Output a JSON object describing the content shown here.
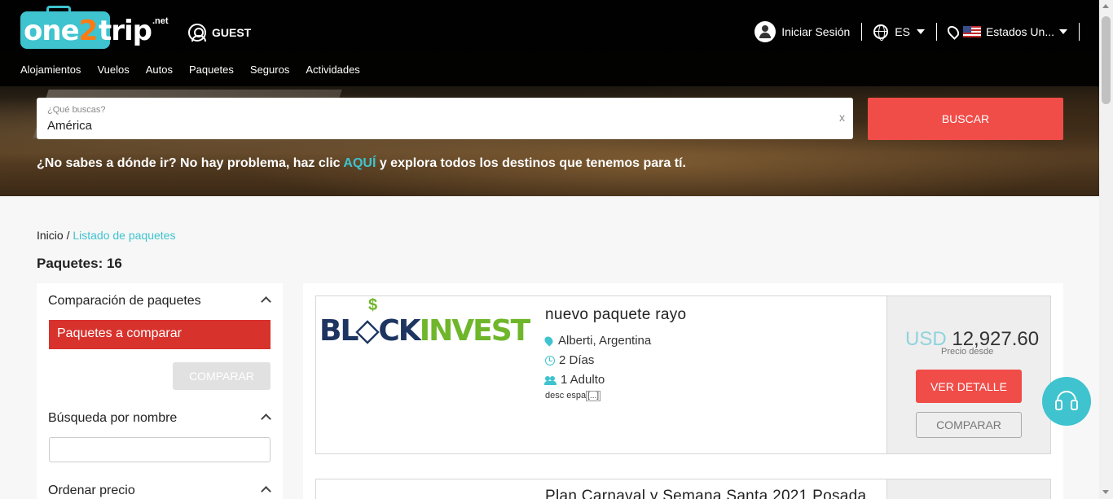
{
  "brand": {
    "name_part1": "one",
    "name_part2": "2",
    "name_part3": "trip",
    "tld": ".net",
    "colors": {
      "accent": "#3ec3cf",
      "orange": "#ff7a12",
      "red": "#f04c48"
    }
  },
  "header": {
    "guest_label": "GUEST",
    "login_label": "Iniciar Sesión",
    "language": "ES",
    "country": "Estados Un...",
    "nav": [
      "Alojamientos",
      "Vuelos",
      "Autos",
      "Paquetes",
      "Seguros",
      "Actividades"
    ]
  },
  "search": {
    "label": "¿Qué buscas?",
    "value": "América",
    "clear": "x",
    "button": "BUSCAR",
    "hint_before": "¿No sabes a dónde ir? No hay problema, haz clic ",
    "hint_link": "AQUÍ",
    "hint_after": " y explora todos los destinos que tenemos para tí."
  },
  "breadcrumb": {
    "home": "Inicio",
    "separator": "/",
    "current": "Listado de paquetes"
  },
  "results_count": "Paquetes: 16",
  "sidebar": {
    "compare_title": "Comparación de paquetes",
    "compare_list_label": "Paquetes a comparar",
    "compare_button": "COMPARAR",
    "name_search_title": "Búsqueda por nombre",
    "name_search_value": "",
    "price_order_title": "Ordenar precio"
  },
  "packages": [
    {
      "logo_text_a": "BL",
      "logo_text_b": "CK",
      "logo_text_c": "INVEST",
      "logo_symbol": "$",
      "title": "nuevo paquete rayo",
      "location": "Alberti, Argentina",
      "duration": "2 Días",
      "guests": "1 Adulto",
      "description": "desc espa",
      "more": "[...]",
      "currency": "USD",
      "price": "12,927.60",
      "price_label": "Precio desde",
      "detail_button": "VER DETALLE",
      "compare_button": "COMPARAR"
    },
    {
      "title": "Plan Carnaval y Semana Santa 2021 Posada"
    }
  ]
}
